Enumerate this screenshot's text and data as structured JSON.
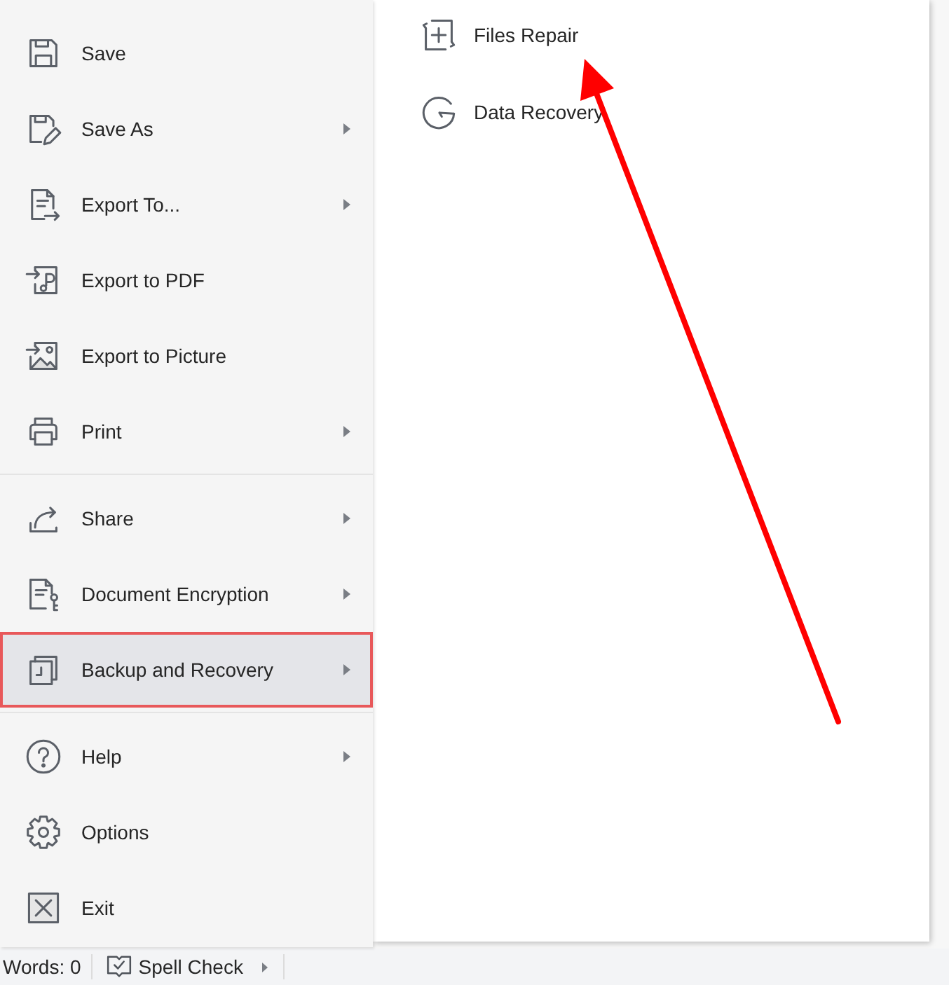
{
  "menu": {
    "groups": [
      {
        "items": [
          {
            "label": "Save",
            "has_submenu": false,
            "selected": false,
            "outlined": false
          },
          {
            "label": "Save As",
            "has_submenu": true,
            "selected": false,
            "outlined": false
          },
          {
            "label": "Export To...",
            "has_submenu": true,
            "selected": false,
            "outlined": false
          },
          {
            "label": "Export to PDF",
            "has_submenu": false,
            "selected": false,
            "outlined": false
          },
          {
            "label": "Export to Picture",
            "has_submenu": false,
            "selected": false,
            "outlined": false
          },
          {
            "label": "Print",
            "has_submenu": true,
            "selected": false,
            "outlined": false
          }
        ]
      },
      {
        "items": [
          {
            "label": "Share",
            "has_submenu": true,
            "selected": false,
            "outlined": false
          },
          {
            "label": "Document Encryption",
            "has_submenu": true,
            "selected": false,
            "outlined": false
          },
          {
            "label": "Backup and Recovery",
            "has_submenu": true,
            "selected": true,
            "outlined": true
          }
        ]
      },
      {
        "items": [
          {
            "label": "Help",
            "has_submenu": true,
            "selected": false,
            "outlined": false
          },
          {
            "label": "Options",
            "has_submenu": false,
            "selected": false,
            "outlined": false
          },
          {
            "label": "Exit",
            "has_submenu": false,
            "selected": false,
            "outlined": false
          }
        ]
      }
    ]
  },
  "submenu": {
    "items": [
      {
        "label": "Files Repair"
      },
      {
        "label": "Data Recovery"
      }
    ]
  },
  "status_bar": {
    "word_count": "Words: 0",
    "spell_check": {
      "label": "Spell Check",
      "has_menu": true
    }
  }
}
